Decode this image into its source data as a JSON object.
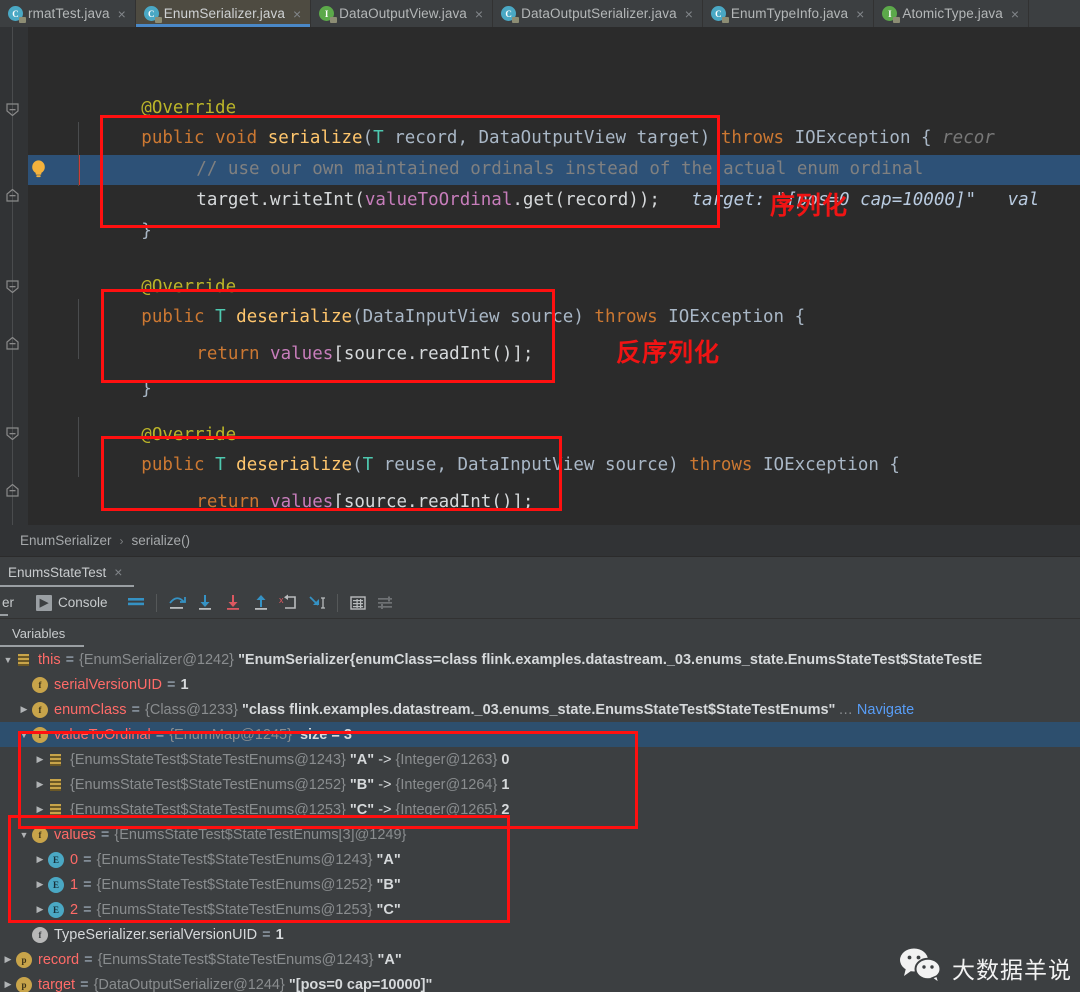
{
  "window": {
    "theme_bg": "#3c3f41",
    "editor_bg": "#2b2b2b",
    "accent": "#4a88c7",
    "annotation_color": "#ff1010"
  },
  "tabs": [
    {
      "label": "rmatTest.java",
      "icon": "java-class-icon",
      "icon_kind": "c",
      "active": false,
      "close": "×"
    },
    {
      "label": "EnumSerializer.java",
      "icon": "java-class-icon",
      "icon_kind": "c",
      "active": true,
      "close": "×"
    },
    {
      "label": "DataOutputView.java",
      "icon": "java-interface-icon",
      "icon_kind": "i",
      "active": false,
      "close": "×"
    },
    {
      "label": "DataOutputSerializer.java",
      "icon": "java-class-icon",
      "icon_kind": "c",
      "active": false,
      "close": "×"
    },
    {
      "label": "EnumTypeInfo.java",
      "icon": "java-class-icon",
      "icon_kind": "c",
      "active": false,
      "close": "×"
    },
    {
      "label": "AtomicType.java",
      "icon": "java-interface-icon",
      "icon_kind": "i",
      "active": false,
      "close": "×"
    }
  ],
  "editor": {
    "lines": {
      "l1_annotation": "@Override",
      "l2_kw_public": "public",
      "l2_kw_void": "void",
      "l2_method": "serialize",
      "l2_paren_open": "(",
      "l2_generic_T": "T",
      "l2_param_record": " record, ",
      "l2_type_dov": "DataOutputView",
      "l2_param_target": " target) ",
      "l2_kw_throws": "throws",
      "l2_ioexception": " IOException { ",
      "l2_hint": "recor",
      "l3_comment": "// use our own maintained ordinals instead of the actual enum ordinal",
      "l4_code_a": "target.writeInt(",
      "l4_field": "valueToOrdinal",
      "l4_code_b": ".get(record));",
      "l4_hint": "target: \"[pos=0 cap=10000]\"   val",
      "l5_brace": "}",
      "l6_annotation": "@Override",
      "l7_kw_public": "public",
      "l7_generic_T": "T",
      "l7_method": "deserialize",
      "l7_paren": "(",
      "l7_type_div": "DataInputView",
      "l7_param": " source) ",
      "l7_kw_throws": "throws",
      "l7_tail": " IOException {",
      "l8_kw_return": "return",
      "l8_values": " values",
      "l8_tail": "[source.readInt()];",
      "l9_brace": "}",
      "l10_annotation": "@Override",
      "l11_kw_public": "public",
      "l11_generic_T": "T",
      "l11_method": "deserialize",
      "l11_paren": "(",
      "l11_generic_T2": "T",
      "l11_param_reuse": " reuse, ",
      "l11_type_div": "DataInputView",
      "l11_param": " source) ",
      "l11_kw_throws": "throws",
      "l11_tail": " IOException {",
      "l12_kw_return": "return",
      "l12_values": " values",
      "l12_tail": "[source.readInt()];",
      "l13_brace": "}"
    },
    "annotations": [
      {
        "label": "序列化",
        "meaning": "serialization"
      },
      {
        "label": "反序列化",
        "meaning": "deserialization"
      }
    ]
  },
  "breadcrumb": {
    "class": "EnumSerializer",
    "separator": "›",
    "method": "serialize()"
  },
  "run_tab": {
    "label": "EnumsStateTest",
    "close": "×"
  },
  "debug_toolbar": {
    "left_label": "er",
    "console_label": "Console",
    "icons": [
      {
        "name": "mute-breakpoints-icon"
      },
      {
        "name": "step-over-icon"
      },
      {
        "name": "step-into-icon"
      },
      {
        "name": "force-step-into-icon"
      },
      {
        "name": "step-out-icon"
      },
      {
        "name": "drop-frame-icon"
      },
      {
        "name": "run-to-cursor-icon"
      },
      {
        "name": "evaluate-expression-icon"
      },
      {
        "name": "settings-icon"
      }
    ]
  },
  "variables": {
    "tab_label": "Variables",
    "rows": [
      {
        "indent": 0,
        "twisty": "▼",
        "icon": "list-icon",
        "icon_kind": "list",
        "name": "this",
        "eq": "=",
        "ref": "{EnumSerializer@1242}",
        "value": "\"EnumSerializer{enumClass=class flink.examples.datastream._03.enums_state.EnumsStateTest$StateTestE",
        "selected": false
      },
      {
        "indent": 1,
        "twisty": "",
        "icon": "field-icon",
        "icon_kind": "f",
        "name": "serialVersionUID",
        "eq": "=",
        "ref": "",
        "value": "1",
        "value_kind": "num",
        "selected": false
      },
      {
        "indent": 1,
        "twisty": "▶",
        "icon": "field-icon",
        "icon_kind": "f",
        "name": "enumClass",
        "eq": "=",
        "ref": "{Class@1233}",
        "value": "\"class flink.examples.datastream._03.enums_state.EnumsStateTest$StateTestEnums\"",
        "dots": "…",
        "navigate": "Navigate",
        "selected": false
      },
      {
        "indent": 1,
        "twisty": "▼",
        "icon": "field-icon",
        "icon_kind": "f",
        "name": "valueToOrdinal",
        "eq": "=",
        "ref": "{EnumMap@1245}",
        "size": "size = 3",
        "value": "",
        "selected": true
      },
      {
        "indent": 2,
        "twisty": "▶",
        "icon": "list-icon",
        "icon_kind": "list",
        "name": "",
        "eq": "",
        "ref": "{EnumsStateTest$StateTestEnums@1243}",
        "value": "\"A\"",
        "arrow": "->",
        "ref2": "{Integer@1263}",
        "value2": "0",
        "selected": false
      },
      {
        "indent": 2,
        "twisty": "▶",
        "icon": "list-icon",
        "icon_kind": "list",
        "name": "",
        "eq": "",
        "ref": "{EnumsStateTest$StateTestEnums@1252}",
        "value": "\"B\"",
        "arrow": "->",
        "ref2": "{Integer@1264}",
        "value2": "1",
        "selected": false
      },
      {
        "indent": 2,
        "twisty": "▶",
        "icon": "list-icon",
        "icon_kind": "list",
        "name": "",
        "eq": "",
        "ref": "{EnumsStateTest$StateTestEnums@1253}",
        "value": "\"C\"",
        "arrow": "->",
        "ref2": "{Integer@1265}",
        "value2": "2",
        "selected": false
      },
      {
        "indent": 1,
        "twisty": "▼",
        "icon": "field-icon",
        "icon_kind": "f",
        "name": "values",
        "eq": "=",
        "ref": "{EnumsStateTest$StateTestEnums[3]@1249}",
        "value": "",
        "selected": false
      },
      {
        "indent": 2,
        "twisty": "▶",
        "icon": "element-icon",
        "icon_kind": "e",
        "name": "0",
        "eq": "=",
        "ref": "{EnumsStateTest$StateTestEnums@1243}",
        "value": "\"A\"",
        "selected": false
      },
      {
        "indent": 2,
        "twisty": "▶",
        "icon": "element-icon",
        "icon_kind": "e",
        "name": "1",
        "eq": "=",
        "ref": "{EnumsStateTest$StateTestEnums@1252}",
        "value": "\"B\"",
        "selected": false
      },
      {
        "indent": 2,
        "twisty": "▶",
        "icon": "element-icon",
        "icon_kind": "e",
        "name": "2",
        "eq": "=",
        "ref": "{EnumsStateTest$StateTestEnums@1253}",
        "value": "\"C\"",
        "selected": false
      },
      {
        "indent": 1,
        "twisty": "",
        "icon": "static-field-icon",
        "icon_kind": "fs",
        "name": "TypeSerializer.serialVersionUID",
        "eq": "=",
        "ref": "",
        "value": "1",
        "value_kind": "num",
        "name_color": "plain",
        "selected": false
      },
      {
        "indent": 0,
        "twisty": "▶",
        "icon": "parameter-icon",
        "icon_kind": "p",
        "name": "record",
        "eq": "=",
        "ref": "{EnumsStateTest$StateTestEnums@1243}",
        "value": "\"A\"",
        "selected": false
      },
      {
        "indent": 0,
        "twisty": "▶",
        "icon": "parameter-icon",
        "icon_kind": "p",
        "name": "target",
        "eq": "=",
        "ref": "{DataOutputSerializer@1244}",
        "value": "\"[pos=0 cap=10000]\"",
        "selected": false
      }
    ]
  },
  "watermark": {
    "text": "大数据羊说",
    "icon": "wechat-icon"
  }
}
